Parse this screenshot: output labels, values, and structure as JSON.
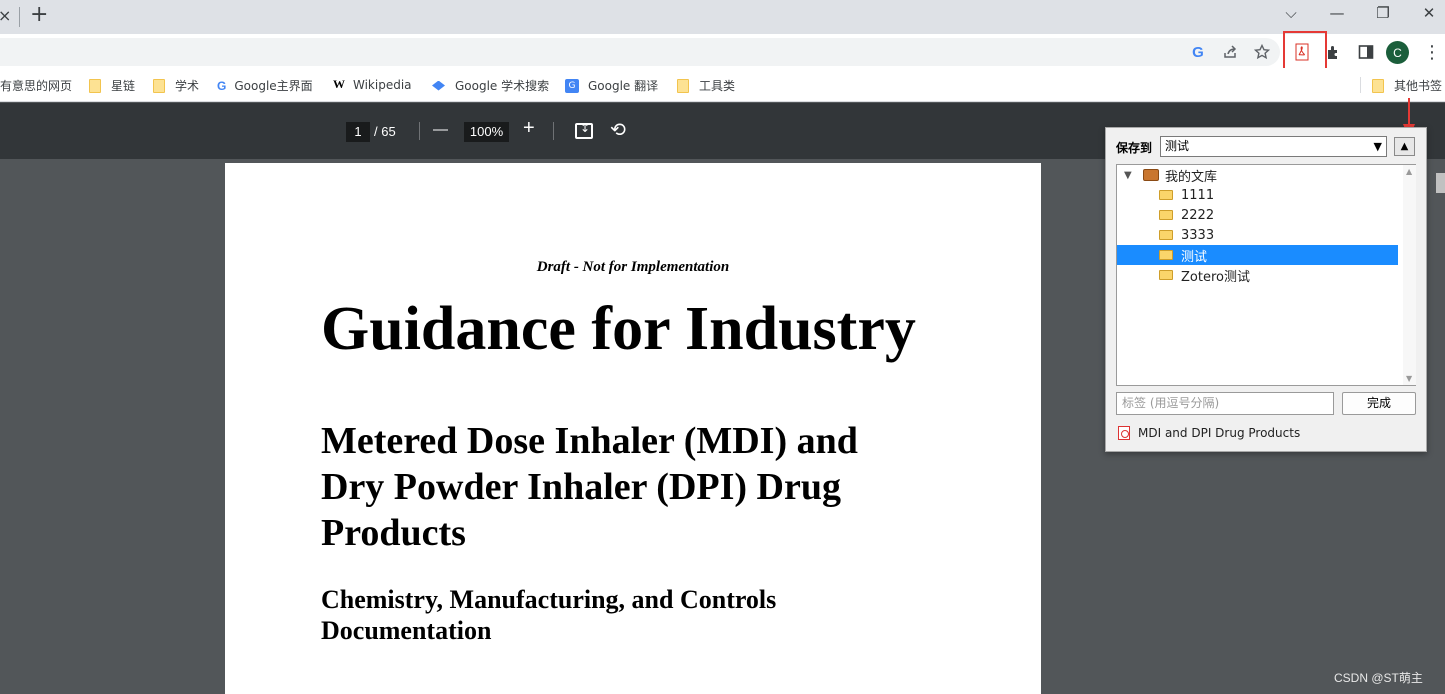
{
  "window": {
    "tab_close": "×",
    "new_tab": "+",
    "controls": {
      "dropdown": "⌵",
      "minimize": "—",
      "restore": "❐",
      "close": "✕"
    }
  },
  "toolbar": {
    "icons": [
      "google-icon",
      "share-icon",
      "star-icon",
      "zotero-pdf-icon",
      "extensions-icon",
      "side-panel-icon",
      "profile-avatar",
      "menu-icon"
    ],
    "avatar_letter": "C",
    "google_letter": "G",
    "menu_glyph": "⋮"
  },
  "bookmarks": {
    "items": [
      {
        "label": "有意思的网页",
        "icon": "none"
      },
      {
        "label": "星链",
        "icon": "folder-icon"
      },
      {
        "label": "学术",
        "icon": "folder-icon"
      },
      {
        "label": "Google主界面",
        "icon": "google-icon"
      },
      {
        "label": "Wikipedia",
        "icon": "wikipedia-icon"
      },
      {
        "label": "Google 学术搜索",
        "icon": "scholar-icon"
      },
      {
        "label": "Google 翻译",
        "icon": "translate-icon"
      },
      {
        "label": "工具类",
        "icon": "folder-icon"
      }
    ],
    "other": "其他书签",
    "g_glyph": "G",
    "w_glyph": "W",
    "translate_glyph": "G"
  },
  "pdf_toolbar": {
    "page_current": "1",
    "page_total": "/ 65",
    "zoom": "100%",
    "minus": "—",
    "plus": "+",
    "rotate_glyph": "⟲"
  },
  "document": {
    "draft_line": "Draft - Not for Implementation",
    "title": "Guidance for Industry",
    "subtitle": "Metered Dose Inhaler (MDI) and Dry Powder Inhaler (DPI) Drug Products",
    "section": "Chemistry, Manufacturing, and Controls Documentation"
  },
  "zotero_popup": {
    "save_to_label": "保存到",
    "selected_collection": "测试",
    "collapse_glyph": "▲",
    "tree": [
      {
        "label": "我的文库",
        "level": 0,
        "type": "library",
        "expanded": true,
        "selected": false
      },
      {
        "label": "1111",
        "level": 1,
        "type": "folder",
        "selected": false
      },
      {
        "label": "2222",
        "level": 1,
        "type": "folder",
        "selected": false
      },
      {
        "label": "3333",
        "level": 1,
        "type": "folder",
        "selected": false
      },
      {
        "label": "测试",
        "level": 1,
        "type": "folder",
        "selected": true
      },
      {
        "label": "Zotero测试",
        "level": 1,
        "type": "folder",
        "selected": false
      }
    ],
    "tags_placeholder": "标签 (用逗号分隔)",
    "done_button": "完成",
    "item_title": "MDI and DPI Drug Products"
  },
  "watermark": "CSDN @ST萌主",
  "colors": {
    "highlight": "#e53935",
    "selection": "#1a8cff",
    "pdf_toolbar": "#323639",
    "viewer_bg": "#525659"
  }
}
